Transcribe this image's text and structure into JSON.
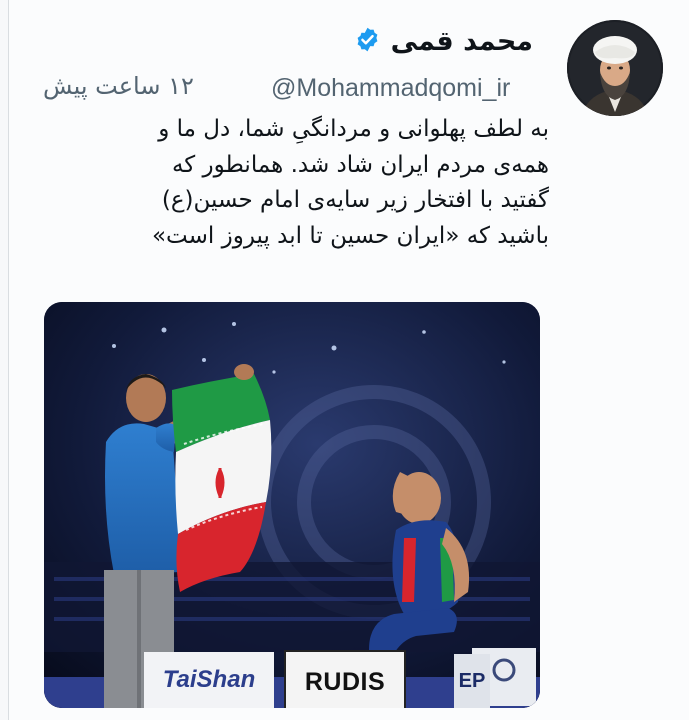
{
  "tweet": {
    "author_name": "محمد قمی",
    "handle": "@Mohammadqomi_ir",
    "time": "۱۲ ساعت پیش",
    "text_lines": [
      "به لطف پهلوانی و مردانگیِ شما، دل ما و",
      "همه‌ی مردم ایران شاد شد. همانطور که",
      "گفتید با افتخار زیر سایه‌ی امام حسین(ع)",
      "باشید که «ایران حسین تا ابد پیروز است»"
    ]
  },
  "media": {
    "sponsors": {
      "left": "TaiShan",
      "center": "RUDIS",
      "right": "EP"
    }
  },
  "icons": {
    "verified": "verified-badge-icon",
    "avatar": "avatar"
  },
  "colors": {
    "verified_blue": "#1d9bf0",
    "secondary_text": "#536471",
    "flag_green": "#1f9a45",
    "flag_red": "#d8252d"
  }
}
